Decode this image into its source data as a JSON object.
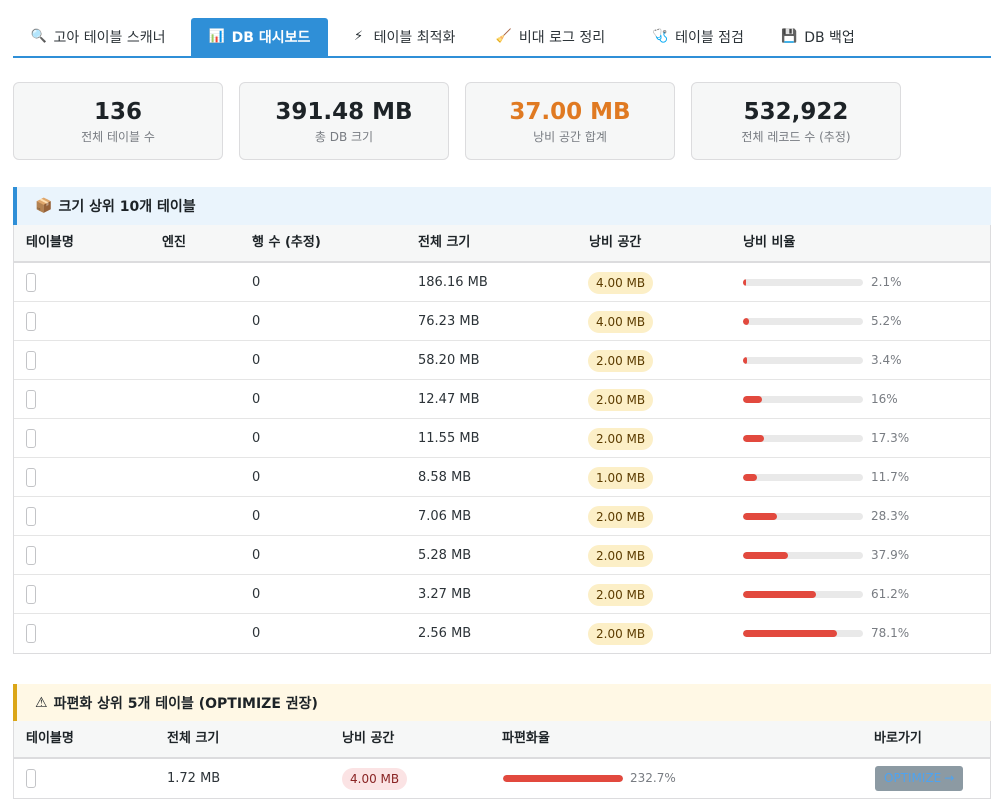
{
  "tabs": [
    {
      "label": "고아 테이블 스캐너",
      "icon": "🔍",
      "icon_name": "search-icon"
    },
    {
      "label": "DB 대시보드",
      "icon": "📊",
      "icon_name": "chart-icon"
    },
    {
      "label": "테이블 최적화",
      "icon": "⚡",
      "icon_name": "lightning-icon"
    },
    {
      "label": "비대 로그 정리",
      "icon": "🧹",
      "icon_name": "broom-icon"
    },
    {
      "label": "테이블 점검",
      "icon": "🩺",
      "icon_name": "stethoscope-icon"
    },
    {
      "label": "DB 백업",
      "icon": "💾",
      "icon_name": "floppy-disk-icon"
    }
  ],
  "stats": [
    {
      "value": "136",
      "label": "전체 테이블 수"
    },
    {
      "value": "391.48 MB",
      "label": "총 DB 크기"
    },
    {
      "value": "37.00 MB",
      "label": "낭비 공간 합계",
      "color": "#e07a22"
    },
    {
      "value": "532,922",
      "label": "전체 레코드 수 (추정)"
    }
  ],
  "top_tables": {
    "title": "크기 상위 10개 테이블",
    "icon": "📦",
    "headers": [
      "테이블명",
      "엔진",
      "행 수 (추정)",
      "전체 크기",
      "낭비 공간",
      "낭비 비율"
    ],
    "rows": [
      {
        "rows": "0",
        "size": "186.16 MB",
        "waste": "4.00 MB",
        "ratio": 2.1,
        "ratio_text": "2.1%"
      },
      {
        "rows": "0",
        "size": "76.23 MB",
        "waste": "4.00 MB",
        "ratio": 5.2,
        "ratio_text": "5.2%"
      },
      {
        "rows": "0",
        "size": "58.20 MB",
        "waste": "2.00 MB",
        "ratio": 3.4,
        "ratio_text": "3.4%"
      },
      {
        "rows": "0",
        "size": "12.47 MB",
        "waste": "2.00 MB",
        "ratio": 16,
        "ratio_text": "16%"
      },
      {
        "rows": "0",
        "size": "11.55 MB",
        "waste": "2.00 MB",
        "ratio": 17.3,
        "ratio_text": "17.3%"
      },
      {
        "rows": "0",
        "size": "8.58 MB",
        "waste": "1.00 MB",
        "ratio": 11.7,
        "ratio_text": "11.7%"
      },
      {
        "rows": "0",
        "size": "7.06 MB",
        "waste": "2.00 MB",
        "ratio": 28.3,
        "ratio_text": "28.3%"
      },
      {
        "rows": "0",
        "size": "5.28 MB",
        "waste": "2.00 MB",
        "ratio": 37.9,
        "ratio_text": "37.9%"
      },
      {
        "rows": "0",
        "size": "3.27 MB",
        "waste": "2.00 MB",
        "ratio": 61.2,
        "ratio_text": "61.2%"
      },
      {
        "rows": "0",
        "size": "2.56 MB",
        "waste": "2.00 MB",
        "ratio": 78.1,
        "ratio_text": "78.1%"
      }
    ]
  },
  "frag_tables": {
    "title": "파편화 상위 5개 테이블 (OPTIMIZE 권장)",
    "icon": "⚠",
    "headers": [
      "테이블명",
      "전체 크기",
      "낭비 공간",
      "파편화율",
      "바로가기"
    ],
    "rows": [
      {
        "size": "1.72 MB",
        "waste": "4.00 MB",
        "ratio": 100,
        "ratio_text": "232.7%",
        "action": "OPTIMIZE",
        "arrow": "→"
      }
    ]
  },
  "colors": {
    "accent": "#2f8fd7",
    "bar_fill": "#e2493e",
    "warn": "#e07a22"
  }
}
